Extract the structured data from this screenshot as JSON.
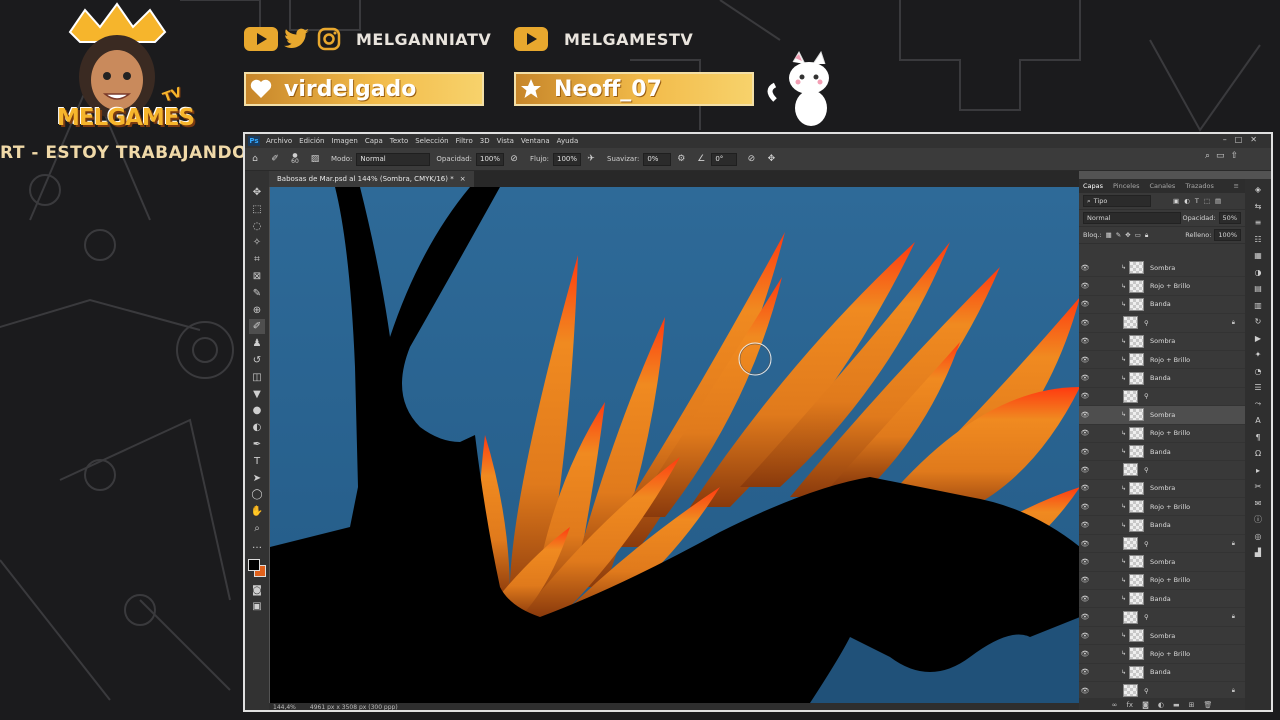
{
  "stream": {
    "social_top_left": "MELGANNIATV",
    "social_top_right": "MELGAMESTV",
    "follower_box_left": "virdelgado",
    "follower_box_right": "Neoff_07",
    "banner_text": "RT - ESTOY TRABAJANDO",
    "logo_text": "MELGAMES",
    "logo_tv": "TV",
    "accent_color": "#e8a82e"
  },
  "ps": {
    "menu": [
      "Archivo",
      "Edición",
      "Imagen",
      "Capa",
      "Texto",
      "Selección",
      "Filtro",
      "3D",
      "Vista",
      "Ventana",
      "Ayuda"
    ],
    "options": {
      "brush_size": "60",
      "mode_label": "Modo:",
      "mode_value": "Normal",
      "opacity_label": "Opacidad:",
      "opacity_value": "100%",
      "flow_label": "Flujo:",
      "flow_value": "100%",
      "smooth_label": "Suavizar:",
      "smooth_value": "0%",
      "angle_value": "0°"
    },
    "doc_tab": "Babosas de Mar.psd al 144% (Sombra, CMYK/16) *",
    "status_zoom": "144,4%",
    "status_size": "4961 px x 3508 px (300 ppp)",
    "panel": {
      "tabs": [
        "Capas",
        "Pinceles",
        "Canales",
        "Trazados"
      ],
      "filter_value": "Tipo",
      "blend_value": "Normal",
      "opacity_label": "Opacidad:",
      "opacity_value": "50%",
      "lock_label": "Bloq.:",
      "fill_label": "Relleno:",
      "fill_value": "100%"
    },
    "layers": [
      {
        "name": "Sombra",
        "group": false,
        "selected": false,
        "locked": false
      },
      {
        "name": "Rojo + Brillo",
        "group": false,
        "selected": false,
        "locked": false
      },
      {
        "name": "Banda",
        "group": false,
        "selected": false,
        "locked": false
      },
      {
        "name": "",
        "group": true,
        "selected": false,
        "locked": true
      },
      {
        "name": "Sombra",
        "group": false,
        "selected": false,
        "locked": false
      },
      {
        "name": "Rojo + Brillo",
        "group": false,
        "selected": false,
        "locked": false
      },
      {
        "name": "Banda",
        "group": false,
        "selected": false,
        "locked": false
      },
      {
        "name": "",
        "group": true,
        "selected": false,
        "locked": false
      },
      {
        "name": "Sombra",
        "group": false,
        "selected": true,
        "locked": false
      },
      {
        "name": "Rojo + Brillo",
        "group": false,
        "selected": false,
        "locked": false
      },
      {
        "name": "Banda",
        "group": false,
        "selected": false,
        "locked": false
      },
      {
        "name": "",
        "group": true,
        "selected": false,
        "locked": false
      },
      {
        "name": "Sombra",
        "group": false,
        "selected": false,
        "locked": false
      },
      {
        "name": "Rojo + Brillo",
        "group": false,
        "selected": false,
        "locked": false
      },
      {
        "name": "Banda",
        "group": false,
        "selected": false,
        "locked": false
      },
      {
        "name": "",
        "group": true,
        "selected": false,
        "locked": true
      },
      {
        "name": "Sombra",
        "group": false,
        "selected": false,
        "locked": false
      },
      {
        "name": "Rojo + Brillo",
        "group": false,
        "selected": false,
        "locked": false
      },
      {
        "name": "Banda",
        "group": false,
        "selected": false,
        "locked": false
      },
      {
        "name": "",
        "group": true,
        "selected": false,
        "locked": true
      },
      {
        "name": "Sombra",
        "group": false,
        "selected": false,
        "locked": false
      },
      {
        "name": "Rojo + Brillo",
        "group": false,
        "selected": false,
        "locked": false
      },
      {
        "name": "Banda",
        "group": false,
        "selected": false,
        "locked": false
      },
      {
        "name": "",
        "group": true,
        "selected": false,
        "locked": true
      }
    ],
    "tool_icons": [
      "move-icon",
      "marquee-icon",
      "lasso-icon",
      "magic-wand-icon",
      "crop-icon",
      "frame-icon",
      "eyedropper-icon",
      "healing-icon",
      "brush-icon",
      "stamp-icon",
      "history-brush-icon",
      "eraser-icon",
      "bucket-icon",
      "blur-icon",
      "dodge-icon",
      "pen-icon",
      "type-icon",
      "path-select-icon",
      "shape-icon",
      "hand-icon",
      "zoom-icon",
      "more-icon"
    ],
    "tool_glyphs": [
      "✥",
      "⬚",
      "◌",
      "✧",
      "⌗",
      "⊠",
      "✎",
      "⊕",
      "✐",
      "♟",
      "↺",
      "◫",
      "▼",
      "●",
      "◐",
      "✒",
      "T",
      "➤",
      "◯",
      "✋",
      "⌕",
      "…"
    ],
    "right_icons": [
      "layers-icon",
      "adjust-icon",
      "properties-icon",
      "libraries-icon",
      "swatches-icon",
      "color-icon",
      "gradient-icon",
      "pattern-icon",
      "history-icon",
      "actions-icon",
      "styles-icon",
      "brush-settings-icon",
      "channels-icon",
      "paths-icon",
      "character-icon",
      "paragraph-icon",
      "glyphs-icon",
      "timeline-icon",
      "tool-presets-icon",
      "notes-icon",
      "info-icon",
      "navigator-icon",
      "histogram-icon"
    ],
    "right_glyphs": [
      "◈",
      "⇆",
      "≡",
      "☷",
      "▦",
      "◑",
      "▤",
      "▥",
      "↻",
      "▶",
      "✦",
      "◔",
      "☰",
      "⤳",
      "A",
      "¶",
      "Ω",
      "▸",
      "✂",
      "✉",
      "ⓘ",
      "◎",
      "▟"
    ],
    "foreground_color": "#000000",
    "background_color": "#e0611c"
  }
}
